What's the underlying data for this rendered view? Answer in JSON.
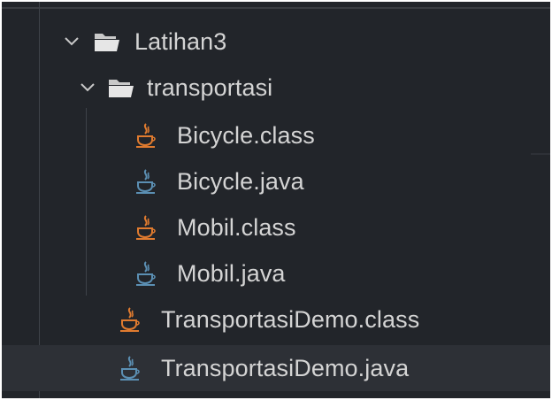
{
  "explorer": {
    "root": {
      "label": "Latihan3",
      "icon": "folder-open-icon",
      "expanded": true
    },
    "subfolder": {
      "label": "transportasi",
      "icon": "folder-open-icon",
      "expanded": true
    },
    "subfolder_files": [
      {
        "label": "Bicycle.class",
        "icon": "java-class-icon"
      },
      {
        "label": "Bicycle.java",
        "icon": "java-file-icon"
      },
      {
        "label": "Mobil.class",
        "icon": "java-class-icon"
      },
      {
        "label": "Mobil.java",
        "icon": "java-file-icon"
      }
    ],
    "root_files": [
      {
        "label": "TransportasiDemo.class",
        "icon": "java-class-icon"
      },
      {
        "label": "TransportasiDemo.java",
        "icon": "java-file-icon",
        "selected": true
      }
    ]
  },
  "colors": {
    "background": "#22252a",
    "selected_row": "#2d3036",
    "text": "#d4d4d4",
    "class_icon": "#e07b2f",
    "java_icon": "#5b8fb3",
    "folder_icon": "#c9c9c9"
  }
}
